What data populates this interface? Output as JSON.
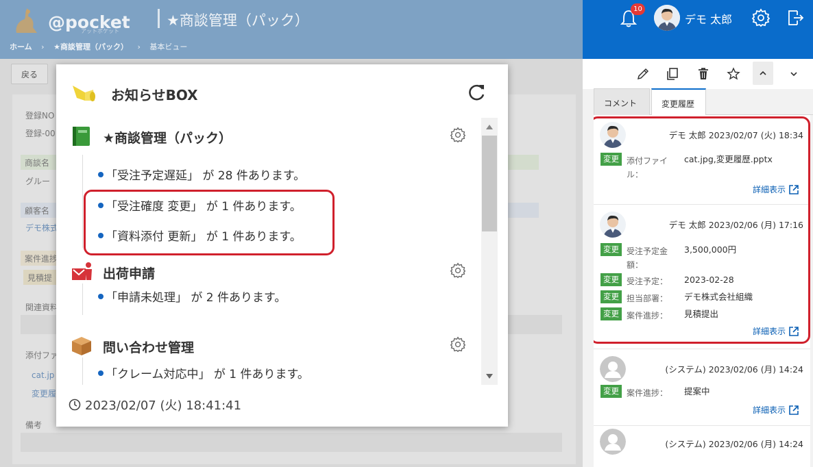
{
  "header": {
    "brand": "@pocket",
    "brand_sub": "アットポケット",
    "title": "★商談管理（パック）",
    "breadcrumb": [
      "ホーム",
      "›",
      "★商談管理（パック）",
      "›",
      "基本ビュー"
    ]
  },
  "toolbar": {
    "back_label": "戻る"
  },
  "background_form": {
    "labels": [
      "登録NO",
      "登録-00",
      "商談名",
      "グルー",
      "顧客名",
      "デモ株式",
      "案件進捗",
      "見積提",
      "関連資料",
      "添付ファ",
      "cat.jp",
      "変更履",
      "備考"
    ]
  },
  "topbar": {
    "notification_count": "10",
    "user_name": "デモ 太郎",
    "colors": {
      "accent": "#0a6ccb"
    }
  },
  "action_icons": [
    "pencil-icon",
    "copy-icon",
    "trash-icon",
    "star-icon",
    "chevron-up-icon",
    "chevron-down-icon"
  ],
  "tabs": [
    {
      "label": "コメント",
      "active": false
    },
    {
      "label": "変更履歴",
      "active": true
    }
  ],
  "history": [
    {
      "author": "デモ 太郎",
      "datetime": "2023/02/07 (火) 18:34",
      "avatar": "person",
      "changes": [
        {
          "badge": "変更",
          "label": "添付ファイル：",
          "value": "cat.jpg,変更履歴.pptx"
        }
      ],
      "detail_link": "詳細表示",
      "highlighted": true
    },
    {
      "author": "デモ 太郎",
      "datetime": "2023/02/06 (月) 17:16",
      "avatar": "person",
      "changes": [
        {
          "badge": "変更",
          "label": "受注予定金額：",
          "value": "3,500,000円"
        },
        {
          "badge": "変更",
          "label": "受注予定：",
          "value": "2023-02-28"
        },
        {
          "badge": "変更",
          "label": "担当部署：",
          "value": "デモ株式会社組織"
        },
        {
          "badge": "変更",
          "label": "案件進捗：",
          "value": "見積提出"
        }
      ],
      "detail_link": "詳細表示",
      "highlighted": true
    },
    {
      "author": "(システム)",
      "datetime": "2023/02/06 (月) 14:24",
      "avatar": "default",
      "changes": [
        {
          "badge": "変更",
          "label": "案件進捗：",
          "value": "提案中"
        }
      ],
      "detail_link": "詳細表示",
      "highlighted": false
    },
    {
      "author": "(システム)",
      "datetime": "2023/02/06 (月) 14:24",
      "avatar": "default",
      "changes": [],
      "detail_link": "",
      "highlighted": false
    }
  ],
  "notice_box": {
    "title": "お知らせBOX",
    "sections": [
      {
        "icon": "green-book-icon",
        "title": "★商談管理（パック）",
        "items": [
          "「受注予定遅延」 が 28 件あります。",
          "「受注確度 変更」 が 1 件あります。",
          "「資料添付 更新」 が 1 件あります。"
        ]
      },
      {
        "icon": "shipping-request-icon",
        "title": "出荷申請",
        "items": [
          "「申請未処理」 が 2 件あります。"
        ]
      },
      {
        "icon": "box-icon",
        "title": "問い合わせ管理",
        "items": [
          "「クレーム対応中」 が 1 件あります。"
        ]
      }
    ],
    "timestamp": "2023/02/07 (火) 18:41:41"
  }
}
